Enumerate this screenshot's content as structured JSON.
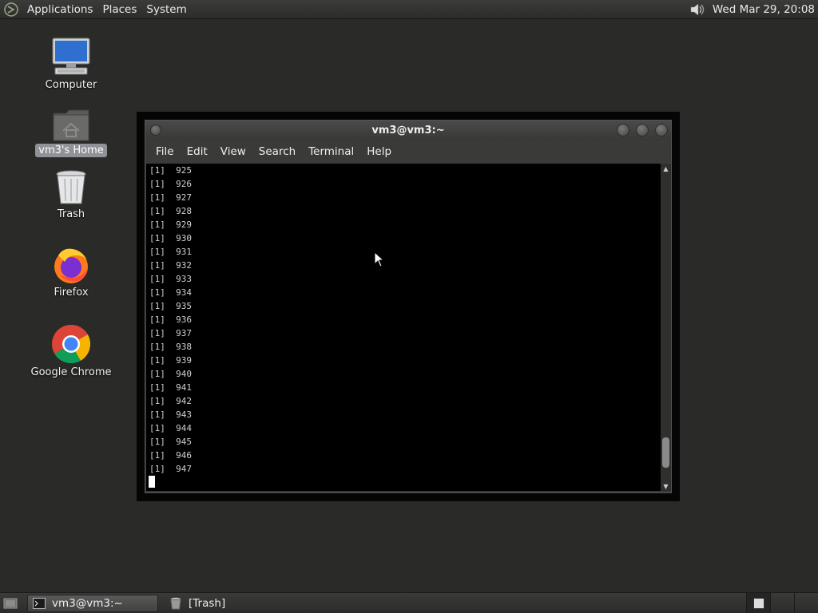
{
  "top_panel": {
    "menus": [
      "Applications",
      "Places",
      "System"
    ],
    "clock": "Wed Mar 29, 20:08"
  },
  "desktop_icons": {
    "computer": "Computer",
    "home": "vm3's Home",
    "trash": "Trash",
    "firefox": "Firefox",
    "chrome": "Google Chrome"
  },
  "terminal": {
    "title": "vm3@vm3:~",
    "menus": [
      "File",
      "Edit",
      "View",
      "Search",
      "Terminal",
      "Help"
    ],
    "lines": [
      "[1]  925",
      "[1]  926",
      "[1]  927",
      "[1]  928",
      "[1]  929",
      "[1]  930",
      "[1]  931",
      "[1]  932",
      "[1]  933",
      "[1]  934",
      "[1]  935",
      "[1]  936",
      "[1]  937",
      "[1]  938",
      "[1]  939",
      "[1]  940",
      "[1]  941",
      "[1]  942",
      "[1]  943",
      "[1]  944",
      "[1]  945",
      "[1]  946",
      "[1]  947"
    ],
    "scroll_position": 0.95
  },
  "taskbar": {
    "tasks": [
      "vm3@vm3:~",
      "[Trash]"
    ]
  }
}
